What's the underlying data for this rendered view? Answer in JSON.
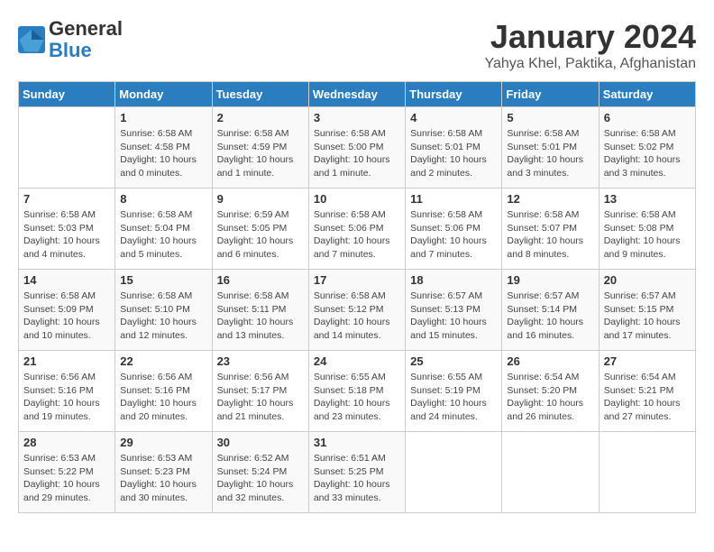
{
  "header": {
    "logo_line1": "General",
    "logo_line2": "Blue",
    "month": "January 2024",
    "location": "Yahya Khel, Paktika, Afghanistan"
  },
  "weekdays": [
    "Sunday",
    "Monday",
    "Tuesday",
    "Wednesday",
    "Thursday",
    "Friday",
    "Saturday"
  ],
  "weeks": [
    [
      {
        "day": "",
        "info": ""
      },
      {
        "day": "1",
        "info": "Sunrise: 6:58 AM\nSunset: 4:58 PM\nDaylight: 10 hours\nand 0 minutes."
      },
      {
        "day": "2",
        "info": "Sunrise: 6:58 AM\nSunset: 4:59 PM\nDaylight: 10 hours\nand 1 minute."
      },
      {
        "day": "3",
        "info": "Sunrise: 6:58 AM\nSunset: 5:00 PM\nDaylight: 10 hours\nand 1 minute."
      },
      {
        "day": "4",
        "info": "Sunrise: 6:58 AM\nSunset: 5:01 PM\nDaylight: 10 hours\nand 2 minutes."
      },
      {
        "day": "5",
        "info": "Sunrise: 6:58 AM\nSunset: 5:01 PM\nDaylight: 10 hours\nand 3 minutes."
      },
      {
        "day": "6",
        "info": "Sunrise: 6:58 AM\nSunset: 5:02 PM\nDaylight: 10 hours\nand 3 minutes."
      }
    ],
    [
      {
        "day": "7",
        "info": "Sunrise: 6:58 AM\nSunset: 5:03 PM\nDaylight: 10 hours\nand 4 minutes."
      },
      {
        "day": "8",
        "info": "Sunrise: 6:58 AM\nSunset: 5:04 PM\nDaylight: 10 hours\nand 5 minutes."
      },
      {
        "day": "9",
        "info": "Sunrise: 6:59 AM\nSunset: 5:05 PM\nDaylight: 10 hours\nand 6 minutes."
      },
      {
        "day": "10",
        "info": "Sunrise: 6:58 AM\nSunset: 5:06 PM\nDaylight: 10 hours\nand 7 minutes."
      },
      {
        "day": "11",
        "info": "Sunrise: 6:58 AM\nSunset: 5:06 PM\nDaylight: 10 hours\nand 7 minutes."
      },
      {
        "day": "12",
        "info": "Sunrise: 6:58 AM\nSunset: 5:07 PM\nDaylight: 10 hours\nand 8 minutes."
      },
      {
        "day": "13",
        "info": "Sunrise: 6:58 AM\nSunset: 5:08 PM\nDaylight: 10 hours\nand 9 minutes."
      }
    ],
    [
      {
        "day": "14",
        "info": "Sunrise: 6:58 AM\nSunset: 5:09 PM\nDaylight: 10 hours\nand 10 minutes."
      },
      {
        "day": "15",
        "info": "Sunrise: 6:58 AM\nSunset: 5:10 PM\nDaylight: 10 hours\nand 12 minutes."
      },
      {
        "day": "16",
        "info": "Sunrise: 6:58 AM\nSunset: 5:11 PM\nDaylight: 10 hours\nand 13 minutes."
      },
      {
        "day": "17",
        "info": "Sunrise: 6:58 AM\nSunset: 5:12 PM\nDaylight: 10 hours\nand 14 minutes."
      },
      {
        "day": "18",
        "info": "Sunrise: 6:57 AM\nSunset: 5:13 PM\nDaylight: 10 hours\nand 15 minutes."
      },
      {
        "day": "19",
        "info": "Sunrise: 6:57 AM\nSunset: 5:14 PM\nDaylight: 10 hours\nand 16 minutes."
      },
      {
        "day": "20",
        "info": "Sunrise: 6:57 AM\nSunset: 5:15 PM\nDaylight: 10 hours\nand 17 minutes."
      }
    ],
    [
      {
        "day": "21",
        "info": "Sunrise: 6:56 AM\nSunset: 5:16 PM\nDaylight: 10 hours\nand 19 minutes."
      },
      {
        "day": "22",
        "info": "Sunrise: 6:56 AM\nSunset: 5:16 PM\nDaylight: 10 hours\nand 20 minutes."
      },
      {
        "day": "23",
        "info": "Sunrise: 6:56 AM\nSunset: 5:17 PM\nDaylight: 10 hours\nand 21 minutes."
      },
      {
        "day": "24",
        "info": "Sunrise: 6:55 AM\nSunset: 5:18 PM\nDaylight: 10 hours\nand 23 minutes."
      },
      {
        "day": "25",
        "info": "Sunrise: 6:55 AM\nSunset: 5:19 PM\nDaylight: 10 hours\nand 24 minutes."
      },
      {
        "day": "26",
        "info": "Sunrise: 6:54 AM\nSunset: 5:20 PM\nDaylight: 10 hours\nand 26 minutes."
      },
      {
        "day": "27",
        "info": "Sunrise: 6:54 AM\nSunset: 5:21 PM\nDaylight: 10 hours\nand 27 minutes."
      }
    ],
    [
      {
        "day": "28",
        "info": "Sunrise: 6:53 AM\nSunset: 5:22 PM\nDaylight: 10 hours\nand 29 minutes."
      },
      {
        "day": "29",
        "info": "Sunrise: 6:53 AM\nSunset: 5:23 PM\nDaylight: 10 hours\nand 30 minutes."
      },
      {
        "day": "30",
        "info": "Sunrise: 6:52 AM\nSunset: 5:24 PM\nDaylight: 10 hours\nand 32 minutes."
      },
      {
        "day": "31",
        "info": "Sunrise: 6:51 AM\nSunset: 5:25 PM\nDaylight: 10 hours\nand 33 minutes."
      },
      {
        "day": "",
        "info": ""
      },
      {
        "day": "",
        "info": ""
      },
      {
        "day": "",
        "info": ""
      }
    ]
  ]
}
